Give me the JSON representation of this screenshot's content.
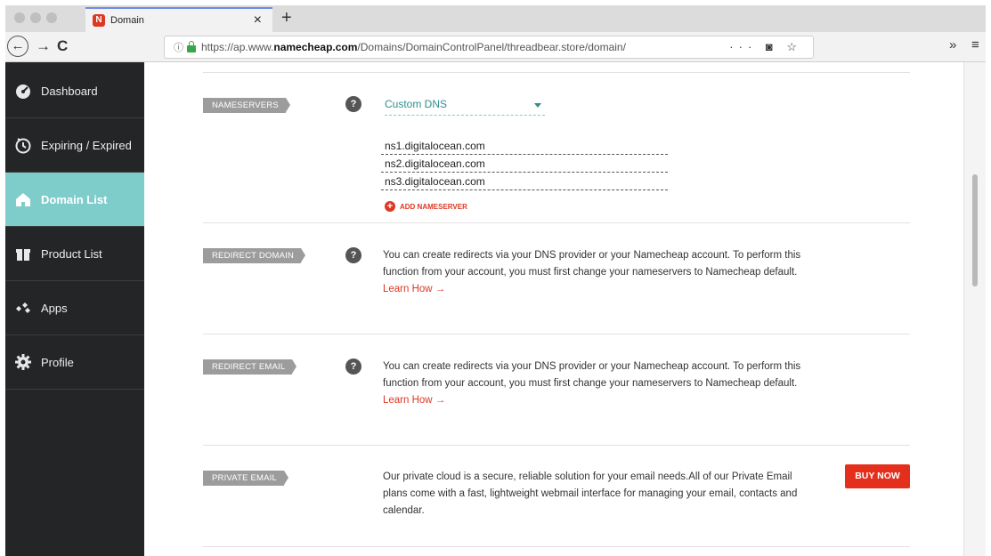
{
  "browser": {
    "tab_title": "Domain",
    "favicon_letter": "N",
    "tab_close": "×",
    "new_tab": "+",
    "back": "←",
    "forward": "→",
    "reload": "C",
    "url_prefix": "https://ap.www.",
    "url_domain": "namecheap.com",
    "url_path": "/Domains/DomainControlPanel/threadbear.store/domain/",
    "url_actions": "··· ◙ ☆",
    "overflow": "»",
    "menu": "≡"
  },
  "sidebar": {
    "items": [
      {
        "label": "Dashboard",
        "icon": "gauge-icon"
      },
      {
        "label": "Expiring / Expired",
        "icon": "timer-icon"
      },
      {
        "label": "Domain List",
        "icon": "home-icon"
      },
      {
        "label": "Product List",
        "icon": "gift-icon"
      },
      {
        "label": "Apps",
        "icon": "apps-icon"
      },
      {
        "label": "Profile",
        "icon": "gear-icon"
      }
    ]
  },
  "sections": {
    "nameservers": {
      "label": "NAMESERVERS",
      "help": "?",
      "dns_type": "Custom DNS",
      "servers": [
        "ns1.digitalocean.com",
        "ns2.digitalocean.com",
        "ns3.digitalocean.com"
      ],
      "add_label": "ADD NAMESERVER"
    },
    "redirect_domain": {
      "label": "REDIRECT DOMAIN",
      "help": "?",
      "text": "You can create redirects via your DNS provider or your Namecheap account. To perform this function from your account, you must first change your nameservers to Namecheap default.",
      "link": "Learn How →"
    },
    "redirect_email": {
      "label": "REDIRECT EMAIL",
      "help": "?",
      "text": "You can create redirects via your DNS provider or your Namecheap account. To perform this function from your account, you must first change your nameservers to Namecheap default.",
      "link": "Learn How →"
    },
    "private_email": {
      "label": "PRIVATE EMAIL",
      "text": "Our private cloud is a secure, reliable solution for your email needs.All of our Private Email plans come with a fast, lightweight webmail interface for managing your email, contacts and calendar.",
      "button": "BUY NOW"
    }
  },
  "colors": {
    "accent": "#7fcdcb",
    "sidebar_bg": "#242526",
    "brand_red": "#de3723",
    "tag_gray": "#9c9c9c"
  }
}
